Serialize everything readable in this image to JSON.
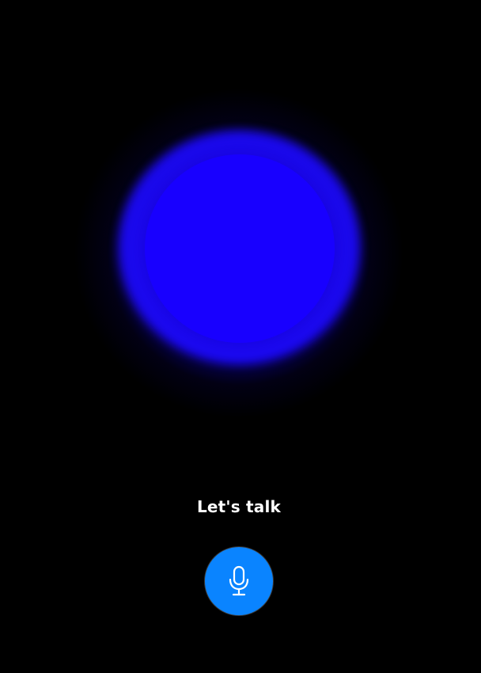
{
  "status": {
    "label": "Let's talk"
  },
  "mic_button": {
    "icon": "microphone-icon",
    "color": "#0a84ff"
  },
  "orb": {
    "color": "#1800ff"
  }
}
